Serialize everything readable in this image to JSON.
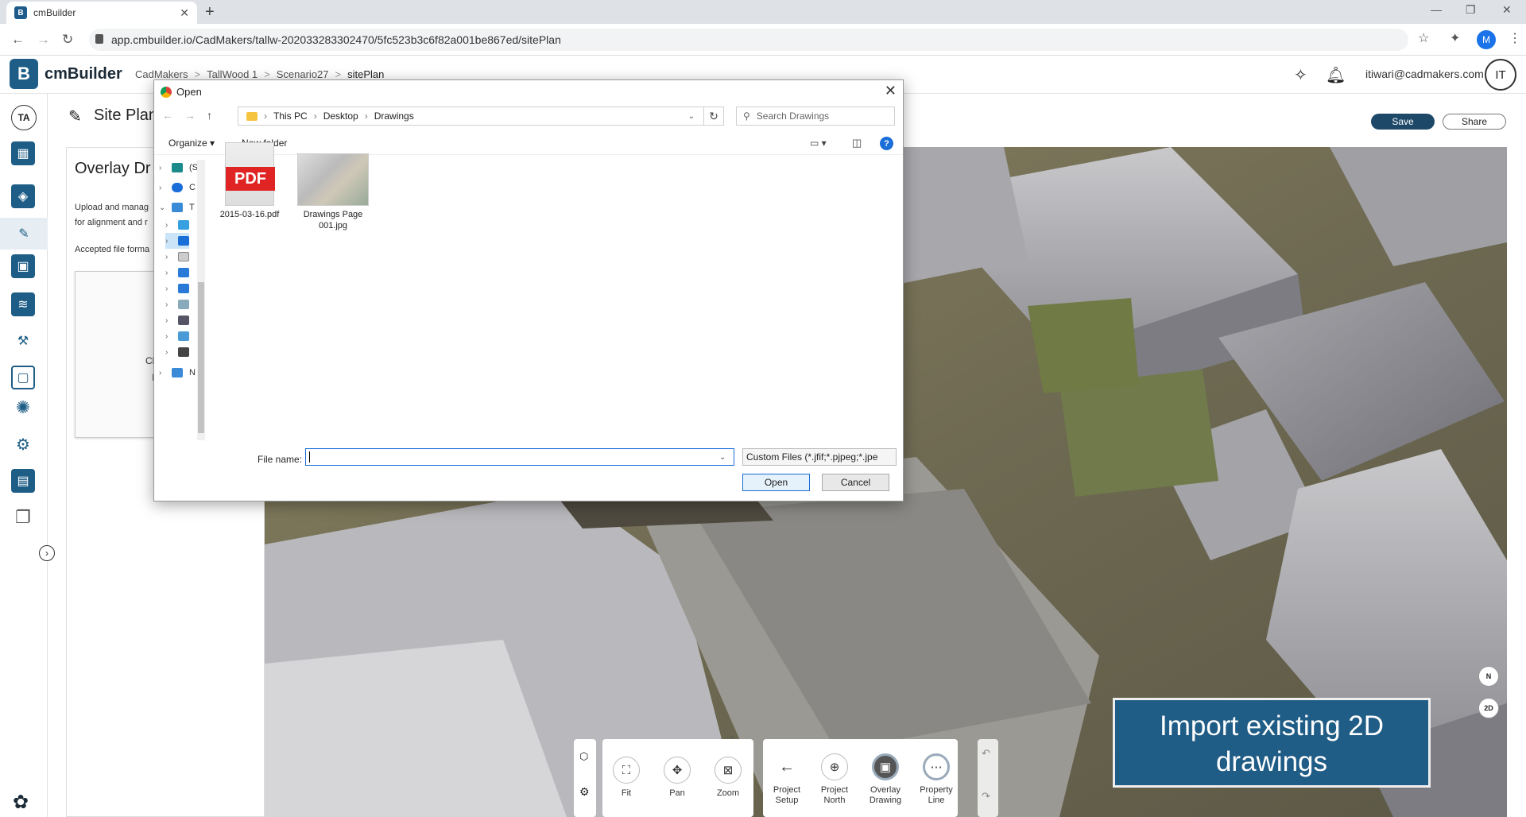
{
  "browser": {
    "tab_title": "cmBuilder",
    "url": "app.cmbuilder.io/CadMakers/tallw-202033283302470/5fc523b3c6f82a001be867ed/sitePlan",
    "profile_initial": "M"
  },
  "header": {
    "brand": "cmBuilder",
    "logo_letter": "B",
    "breadcrumbs": [
      "CadMakers",
      "TallWood 1",
      "Scenario27",
      "sitePlan"
    ],
    "email": "itiwari@cadmakers.com",
    "user_initials": "IT"
  },
  "sidebar": {
    "user_initials": "TA",
    "items": [
      "layout-icon",
      "chart-icon",
      "pen-icon",
      "monitor-icon",
      "layers-icon",
      "tools-icon",
      "frame-icon",
      "sun-icon",
      "gears-icon",
      "report-icon",
      "copy-icon"
    ]
  },
  "page": {
    "title": "Site Plan",
    "save_label": "Save",
    "share_label": "Share"
  },
  "panel": {
    "title": "Overlay Dr",
    "desc_line1": "Upload and manag",
    "desc_line2": "for alignment and r",
    "accepted": "Accepted file forma",
    "drop_line1": "Click or dr",
    "drop_line2": "here to"
  },
  "dialog": {
    "title": "Open",
    "path": [
      "This PC",
      "Desktop",
      "Drawings"
    ],
    "search_placeholder": "Search Drawings",
    "organize_label": "Organize",
    "new_folder_label": "New folder",
    "nav_items": [
      "(S",
      "C",
      "T",
      "",
      "",
      "",
      "",
      "",
      "",
      "",
      "",
      "",
      "N"
    ],
    "files": [
      {
        "name": "2015-03-16.pdf",
        "type": "pdf"
      },
      {
        "name_line1": "Drawings Page",
        "name_line2": "001.jpg",
        "type": "jpg"
      }
    ],
    "file_name_label": "File name:",
    "file_name_value": "",
    "file_type": "Custom Files (*.jfif;*.pjpeg;*.jpe",
    "open_label": "Open",
    "cancel_label": "Cancel"
  },
  "toolbar": {
    "tools": [
      {
        "label": "Fit",
        "icon": "fit-icon"
      },
      {
        "label": "Pan",
        "icon": "pan-icon"
      },
      {
        "label": "Zoom",
        "icon": "zoom-icon"
      }
    ],
    "project_setup_line1": "Project",
    "project_setup_line2": "Setup",
    "project_north_line1": "Project",
    "project_north_line2": "North",
    "overlay_line1": "Overlay",
    "overlay_line2": "Drawing",
    "property_line1": "Property",
    "property_line2": "Line"
  },
  "banner": {
    "line1": "Import existing 2D",
    "line2": "drawings"
  },
  "map_controls": {
    "north": "N",
    "view_mode": "2D"
  }
}
